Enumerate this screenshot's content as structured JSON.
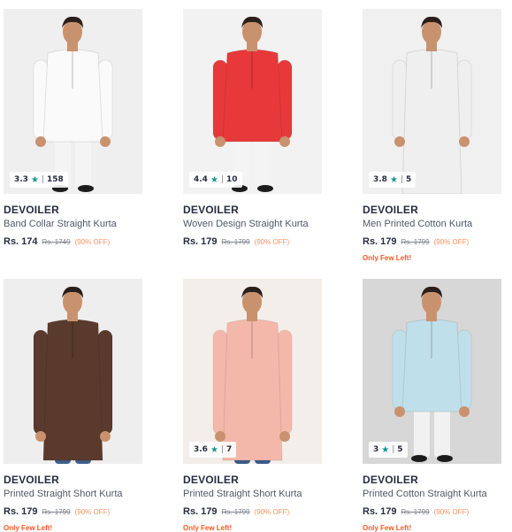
{
  "products": [
    {
      "brand": "DEVOILER",
      "title": "Band Collar Straight Kurta",
      "price": "Rs. 174",
      "mrp": "Rs. 1749",
      "discount": "(90% OFF)",
      "rating": "3.3",
      "count": "158",
      "bg": "#efeff0",
      "kurta_color": "#fafafa",
      "pant_color": "#f4f4f4",
      "tag": ""
    },
    {
      "brand": "DEVOILER",
      "title": "Woven Design Straight Kurta",
      "price": "Rs. 179",
      "mrp": "Rs. 1799",
      "discount": "(90% OFF)",
      "rating": "4.4",
      "count": "10",
      "bg": "#f2f2f2",
      "kurta_color": "#e8393a",
      "pant_color": "#f4f4f4",
      "tag": ""
    },
    {
      "brand": "DEVOILER",
      "title": "Men Printed Cotton Kurta",
      "price": "Rs. 179",
      "mrp": "Rs. 1799",
      "discount": "(90% OFF)",
      "rating": "3.8",
      "count": "5",
      "bg": "#f0f0f1",
      "kurta_color": "#efefef",
      "pant_color": "#4a6ea5",
      "tag": "Only Few Left!"
    },
    {
      "brand": "DEVOILER",
      "title": "Printed Straight Short Kurta",
      "price": "Rs. 179",
      "mrp": "Rs. 1799",
      "discount": "(90% OFF)",
      "rating": "",
      "count": "",
      "bg": "#eeeeef",
      "kurta_color": "#5a3a2c",
      "pant_color": "#3f5f8c",
      "tag": "Only Few Left!"
    },
    {
      "brand": "DEVOILER",
      "title": "Printed Straight Short Kurta",
      "price": "Rs. 179",
      "mrp": "Rs. 1799",
      "discount": "(90% OFF)",
      "rating": "3.6",
      "count": "7",
      "bg": "#f3eeea",
      "kurta_color": "#f4b8ab",
      "pant_color": "#3d5a8a",
      "tag": "Only Few Left!"
    },
    {
      "brand": "DEVOILER",
      "title": "Printed Cotton Straight Kurta",
      "price": "Rs. 179",
      "mrp": "Rs. 1799",
      "discount": "(90% OFF)",
      "rating": "3",
      "count": "5",
      "bg": "#d7d7d8",
      "kurta_color": "#bfe0ea",
      "pant_color": "#f1f1f1",
      "tag": "Only Few Left!"
    }
  ],
  "icons": {
    "rating": "star-icon"
  },
  "colors": {
    "star": "#14958f",
    "discount": "#ff905a",
    "few_left": "#ff5722"
  }
}
